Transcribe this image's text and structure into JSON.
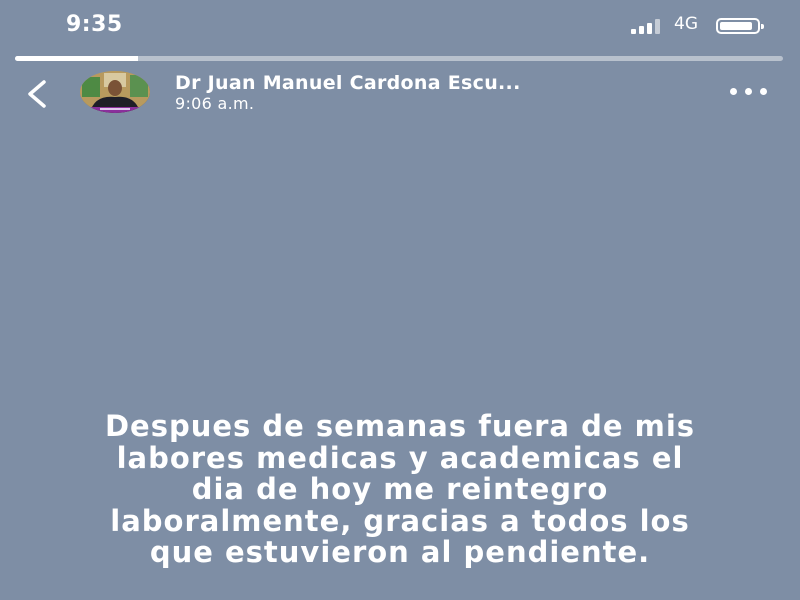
{
  "status_bar": {
    "time": "9:35",
    "network": "4G",
    "signal_bars_active": 3,
    "signal_bars_total": 4,
    "battery_level": 0.9
  },
  "story_progress": 0.16,
  "header": {
    "account_name": "Dr Juan Manuel Cardona Escu...",
    "post_time": "9:06 a.m.",
    "back_icon": "chevron-left-icon",
    "more_icon": "more-horizontal-icon"
  },
  "story": {
    "text": "Despues de semanas fuera de mis\nlabores medicas y academicas el\ndia de hoy me reintegro\nlaboralmente,  gracias a todos los\nque estuvieron al pendiente."
  },
  "colors": {
    "background": "#7e8ea5",
    "foreground": "#ffffff"
  }
}
